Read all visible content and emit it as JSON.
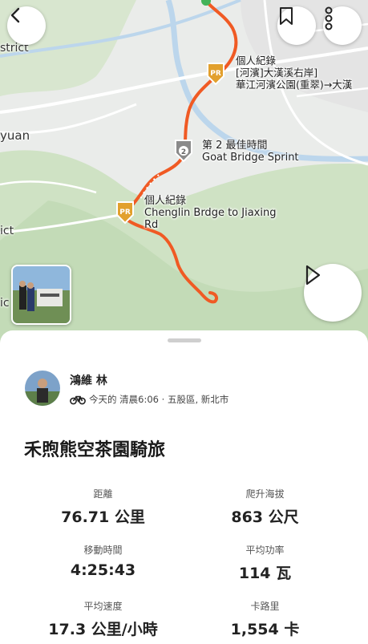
{
  "map": {
    "place_labels": [
      "strict",
      "yuan",
      "ict",
      "ic"
    ],
    "segments": [
      {
        "badge": "PR",
        "lines": [
          "個人紀錄",
          "[河濱]大漢溪右岸]",
          "華江河濱公園(重翠)→大漢"
        ]
      },
      {
        "badge": "2",
        "lines": [
          "第 2 最佳時間",
          "Goat  Bridge Sprint"
        ]
      },
      {
        "badge": "PR",
        "lines": [
          "個人紀錄",
          "Chenglin Brdge to Jiaxing",
          "Rd"
        ]
      }
    ],
    "colors": {
      "route": "#f05a24",
      "badge_gold": "#e2a02d",
      "badge_grey": "#8a8a8a"
    }
  },
  "header": {
    "back_icon": "chevron-left-icon",
    "bookmark_icon": "bookmark-icon",
    "more_icon": "more-vertical-icon",
    "play_icon": "play-icon"
  },
  "activity": {
    "athlete_name": "鴻維 林",
    "sport_icon": "bike-icon",
    "meta": "今天的 清晨6:06 · 五股區, 新北市",
    "title": "禾煦熊空茶園騎旅"
  },
  "stats": [
    {
      "label": "距離",
      "value": "76.71 公里"
    },
    {
      "label": "爬升海拔",
      "value": "863 公尺"
    },
    {
      "label": "移動時間",
      "value": "4:25:43"
    },
    {
      "label": "平均功率",
      "value": "114 瓦"
    },
    {
      "label": "平均速度",
      "value": "17.3 公里/小時"
    },
    {
      "label": "卡路里",
      "value": "1,554 卡"
    }
  ]
}
